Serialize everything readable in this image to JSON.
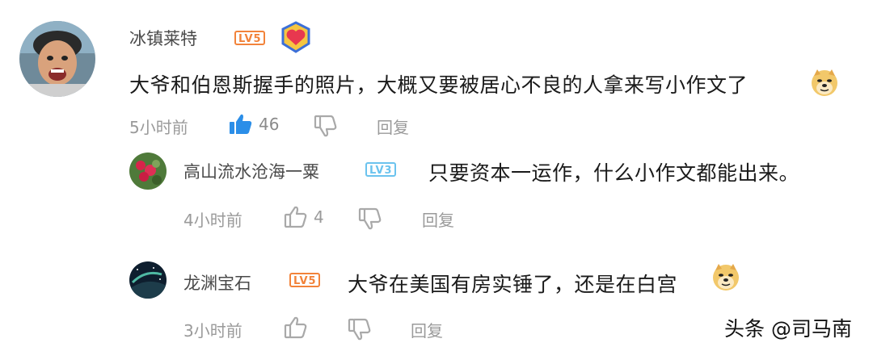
{
  "comments": [
    {
      "user": "冰镇莱特",
      "level": "LV5",
      "text": "大爷和伯恩斯握手的照片，大概又要被居心不良的人拿来写小作文了",
      "time": "5小时前",
      "likes": "46",
      "reply_label": "回复"
    },
    {
      "user": "高山流水沧海一粟",
      "level": "LV3",
      "text": "只要资本一运作，什么小作文都能出来。",
      "time": "4小时前",
      "likes": "4",
      "reply_label": "回复"
    },
    {
      "user": "龙渊宝石",
      "level": "LV5",
      "text": "大爷在美国有房实锤了，还是在白宫",
      "time": "3小时前",
      "likes": "",
      "reply_label": "回复"
    }
  ],
  "watermark": "头条 @司马南",
  "colors": {
    "like_active": "#2b8ee8",
    "icon_gray": "#a9a9a9",
    "level_orange": "#f2833a",
    "level_blue": "#6bc3ee"
  }
}
